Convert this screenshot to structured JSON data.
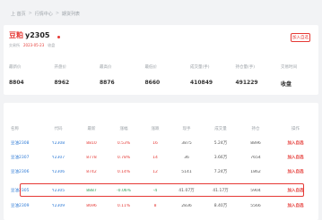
{
  "breadcrumb": [
    "上 首页",
    "行情中心",
    "期货列表"
  ],
  "header": {
    "name": "豆粕",
    "code": "y2305",
    "subtitle": [
      "交易所",
      "2023-05-23",
      "收盘"
    ],
    "add_button": "加入自选"
  },
  "stats": [
    {
      "label": "最新价",
      "value": "8804"
    },
    {
      "label": "开盘价",
      "value": "8962"
    },
    {
      "label": "最高价",
      "value": "8876"
    },
    {
      "label": "最低价",
      "value": "8660"
    },
    {
      "label": "成交量(手)",
      "value": "410849"
    },
    {
      "label": "持仓量(手)",
      "value": "491229"
    },
    {
      "label": "交易时间",
      "value": "收盘"
    }
  ],
  "table": {
    "headers": [
      "名称",
      "代码",
      "最新",
      "涨幅",
      "涨跌",
      "现手",
      "成交量",
      "持仓",
      "操作"
    ],
    "rows": [
      {
        "cells": [
          "豆油2308",
          "Y2308",
          "8810",
          "0.53%",
          "16",
          "3875",
          "5.24万",
          "8896",
          "加入自选"
        ],
        "dir": "up"
      },
      {
        "cells": [
          "豆油2307",
          "Y2307",
          "8778",
          "0.78%",
          "14",
          "36",
          "3.66万",
          "7654",
          "加入自选"
        ],
        "dir": "up"
      },
      {
        "cells": [
          "豆油2306",
          "Y2306",
          "8742",
          "0.14%",
          "12",
          "5141",
          "7.24万",
          "1862",
          "加入自选"
        ],
        "dir": "up"
      },
      {
        "cells": [
          "豆油2305",
          "Y2305",
          "8887",
          "-0.06%",
          "-4",
          "41.07万",
          "41.17万",
          "5904",
          "加入自选"
        ],
        "dir": "down"
      },
      {
        "cells": [
          "豆油2309",
          "Y2309",
          "8696",
          "0.11%",
          "8",
          "2836",
          "8.40万",
          "5566",
          "加入自选"
        ],
        "dir": "up"
      }
    ]
  },
  "colors": {
    "accent": "#e53935",
    "link": "#2f7bd6",
    "down": "#2e9e5a"
  }
}
